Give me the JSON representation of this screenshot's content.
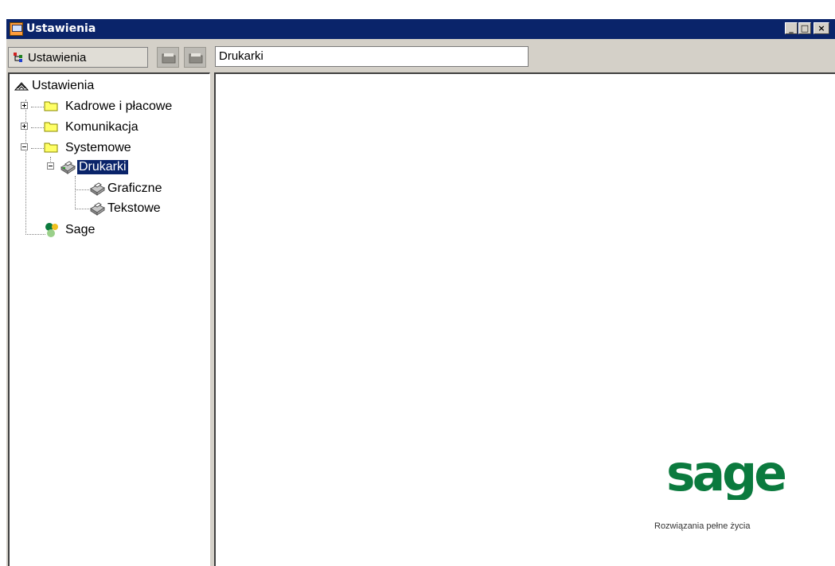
{
  "window": {
    "title": "Ustawienia",
    "controls": {
      "minimize": "_",
      "maximize": "□",
      "close": "×"
    }
  },
  "toolbar": {
    "tree_selector_label": "Ustawienia",
    "buttons": [
      {
        "icon": "folder-grey-icon"
      },
      {
        "icon": "folder-grey-icon"
      }
    ]
  },
  "path_field": {
    "value": "Drukarki"
  },
  "tree": {
    "root": {
      "label": "Ustawienia",
      "icon": "settings-root-icon"
    },
    "items": [
      {
        "label": "Kadrowe i płacowe",
        "icon": "folder-icon",
        "expander": "plus"
      },
      {
        "label": "Komunikacja",
        "icon": "folder-icon",
        "expander": "plus"
      },
      {
        "label": "Systemowe",
        "icon": "folder-icon",
        "expander": "minus"
      },
      {
        "label": "Drukarki",
        "icon": "printer-icon",
        "expander": "minus",
        "selected": true
      },
      {
        "label": "Graficzne",
        "icon": "printer-icon"
      },
      {
        "label": "Tekstowe",
        "icon": "printer-icon"
      },
      {
        "label": "Sage",
        "icon": "sage-icon"
      }
    ]
  },
  "branding": {
    "logo_text": "sage",
    "tagline": "Rozwiązania pełne życia",
    "logo_color": "#0b7a3e"
  }
}
